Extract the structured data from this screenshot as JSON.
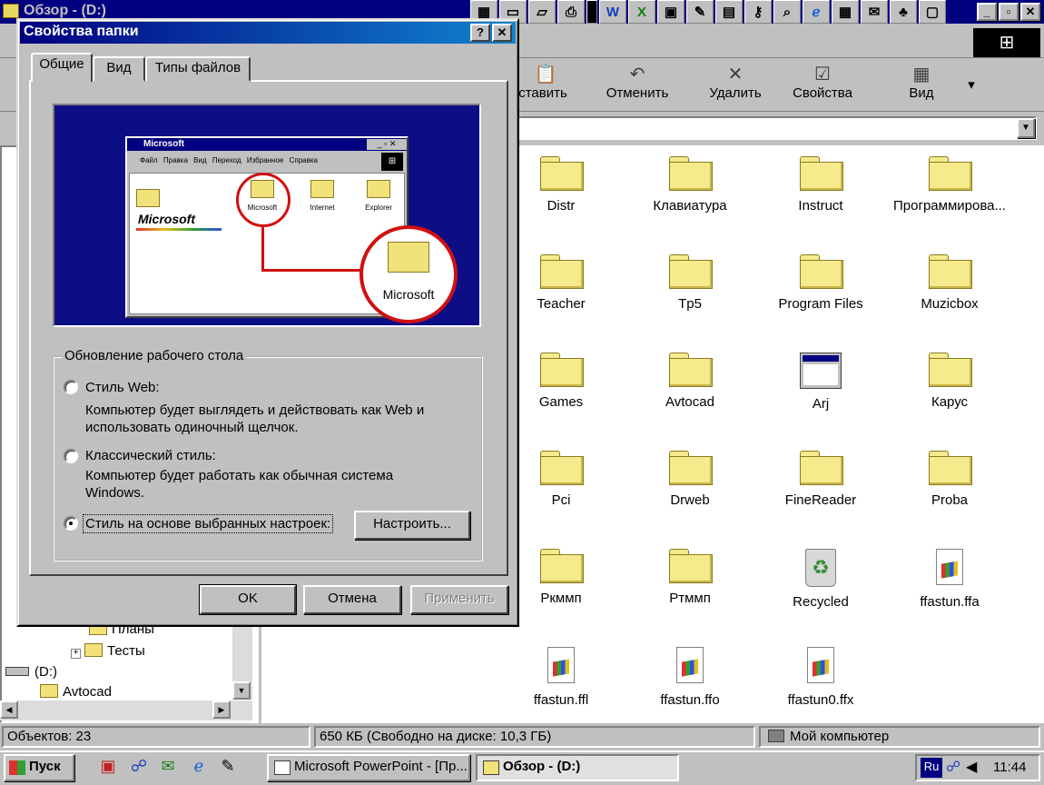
{
  "explorer": {
    "title": "Обзор -  (D:)",
    "toolbar": [
      "Вставить",
      "Отменить",
      "Удалить",
      "Свойства",
      "Вид"
    ],
    "quicklaunch_icons": [
      "W",
      "X",
      "P",
      "A"
    ],
    "tree": {
      "items": [
        "Планы",
        "Тесты",
        "(D:)",
        "Avtocad"
      ]
    },
    "files": [
      {
        "name": "Distr",
        "type": "folder"
      },
      {
        "name": "Клавиатура",
        "type": "folder"
      },
      {
        "name": "Instruct",
        "type": "folder"
      },
      {
        "name": "Программирова...",
        "type": "folder"
      },
      {
        "name": "Teacher",
        "type": "folder"
      },
      {
        "name": "Tp5",
        "type": "folder"
      },
      {
        "name": "Program Files",
        "type": "folder"
      },
      {
        "name": "Muzicbox",
        "type": "folder"
      },
      {
        "name": "Games",
        "type": "folder"
      },
      {
        "name": "Avtocad",
        "type": "folder"
      },
      {
        "name": "Arj",
        "type": "app"
      },
      {
        "name": "Карус",
        "type": "folder"
      },
      {
        "name": "Pci",
        "type": "folder"
      },
      {
        "name": "Drweb",
        "type": "folder"
      },
      {
        "name": "FineReader",
        "type": "folder"
      },
      {
        "name": "Proba",
        "type": "folder"
      },
      {
        "name": "Ркммп",
        "type": "folder"
      },
      {
        "name": "Ртммп",
        "type": "folder"
      },
      {
        "name": "Recycled",
        "type": "recycle"
      },
      {
        "name": "ffastun.ffa",
        "type": "doc"
      },
      {
        "name": "ffastun.ffl",
        "type": "doc"
      },
      {
        "name": "ffastun.ffo",
        "type": "doc"
      },
      {
        "name": "ffastun0.ffx",
        "type": "doc"
      }
    ],
    "status": {
      "objects": "Объектов: 23",
      "free": "650 КБ (Свободно на диске: 10,3 ГБ)",
      "location": "Мой компьютер"
    }
  },
  "dialog": {
    "title": "Свойства папки",
    "help": "?",
    "close": "✕",
    "tabs": [
      "Общие",
      "Вид",
      "Типы файлов"
    ],
    "preview": {
      "window_title": "Microsoft",
      "menu": "Файл Правка Вид Переход Избранное Справка",
      "brand": "Microsoft",
      "folders": [
        "Microsoft",
        "Internet",
        "Explorer"
      ],
      "zoom_label": "Microsoft"
    },
    "group_label": "Обновление рабочего стола",
    "options": [
      {
        "label": "Стиль Web:",
        "desc1": "Компьютер будет выглядеть и действовать как Web и",
        "desc2": "использовать одиночный щелчок.",
        "selected": false
      },
      {
        "label": "Классический стиль:",
        "desc1": "Компьютер будет работать как обычная система",
        "desc2": "Windows.",
        "selected": false
      },
      {
        "label": "Стиль на основе выбранных настроек:",
        "selected": true
      }
    ],
    "customize": "Настроить...",
    "ok": "OK",
    "cancel": "Отмена",
    "apply": "Применить"
  },
  "taskbar": {
    "start": "Пуск",
    "tasks": [
      "Microsoft PowerPoint - [Пр...",
      "Обзор -  (D:)"
    ],
    "lang": "Ru",
    "clock": "11:44"
  }
}
